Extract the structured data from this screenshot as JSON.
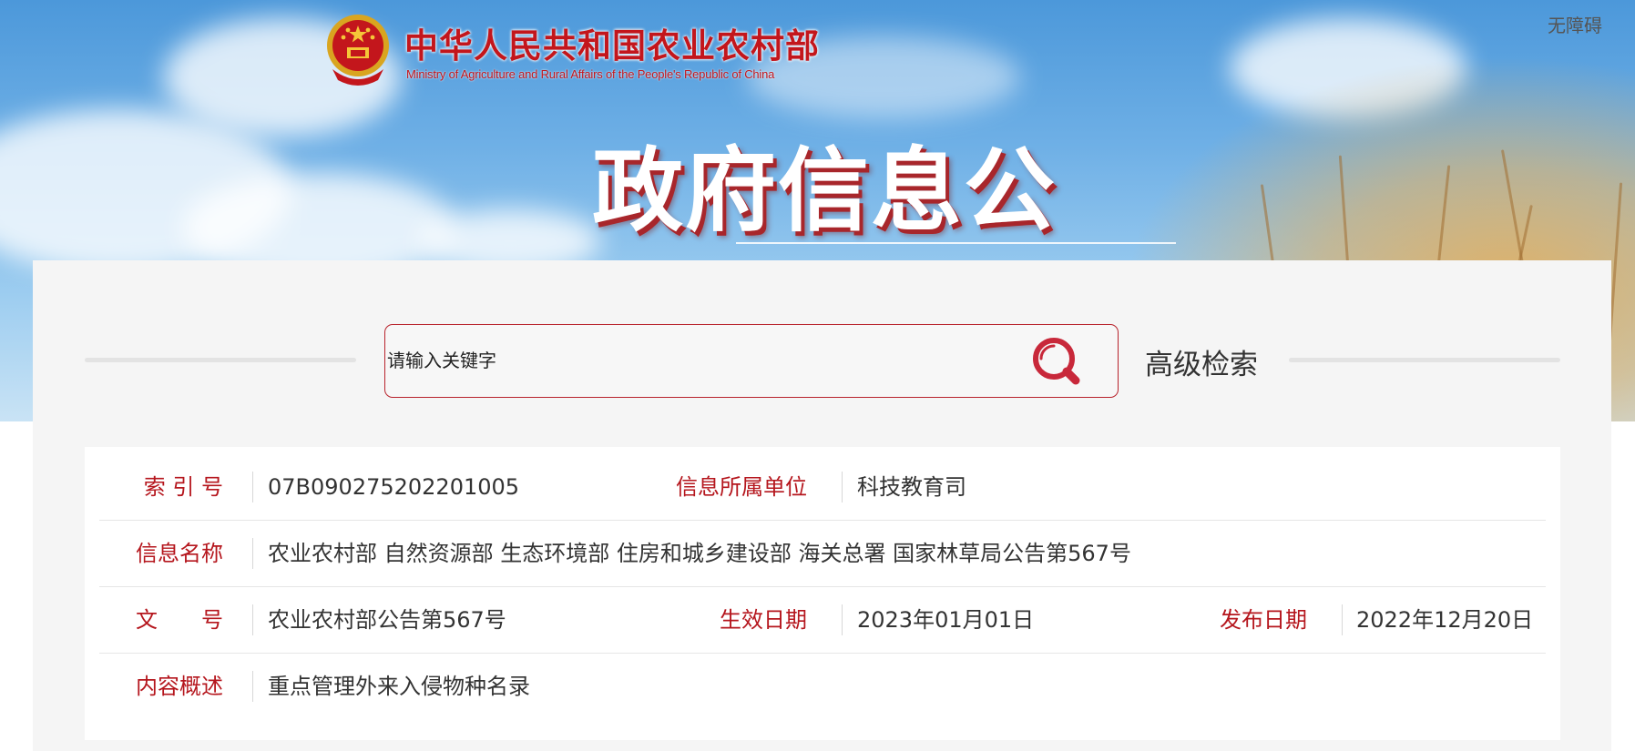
{
  "header": {
    "accessibility_label": "无障碍",
    "logo_cn": "中华人民共和国农业农村部",
    "logo_en": "Ministry of Agriculture and Rural Affairs of the People's Republic of China",
    "page_title": "政府信息公开"
  },
  "search": {
    "placeholder": "请输入关键字",
    "button_icon": "search-icon",
    "advanced_label": "高级检索"
  },
  "info": {
    "index_label": "索 引 号",
    "index_value": "07B090275202201005",
    "unit_label": "信息所属单位",
    "unit_value": "科技教育司",
    "name_label": "信息名称",
    "name_value": "农业农村部 自然资源部 生态环境部 住房和城乡建设部 海关总署 国家林草局公告第567号",
    "doc_label": "文　　号",
    "doc_value": "农业农村部公告第567号",
    "effective_label": "生效日期",
    "effective_value": "2023年01月01日",
    "publish_label": "发布日期",
    "publish_value": "2022年12月20日",
    "summary_label": "内容概述",
    "summary_value": "重点管理外来入侵物种名录"
  },
  "colors": {
    "accent_red": "#b5161d",
    "banner_sky": "#4c98da",
    "panel_bg": "#f5f5f5"
  }
}
